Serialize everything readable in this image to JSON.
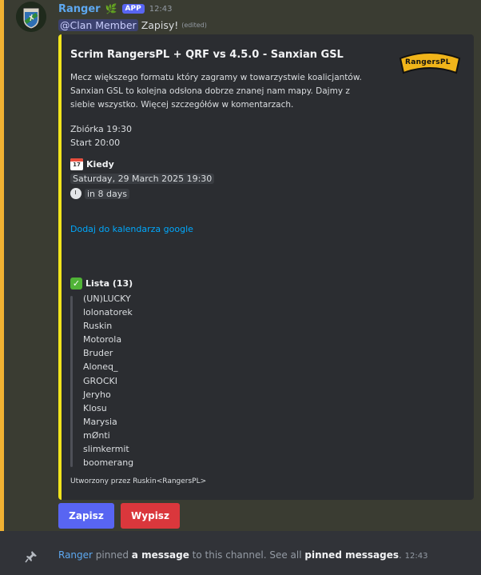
{
  "message": {
    "username": "Ranger",
    "badge": "APP",
    "time": "12:43",
    "mention": "@Clan Member",
    "text": "Zapisy!",
    "edited": "(edited)"
  },
  "embed": {
    "title": "Scrim RangersPL + QRF vs 4.5.0 - Sanxian GSL",
    "description_lines": [
      "Mecz większego formatu który zagramy w towarzystwie koalicjantów.",
      "Sanxian GSL to kolejna odsłona dobrze znanej nam mapy. Dajmy z",
      "siebie wszystko. Więcej szczegółów w komentarzach."
    ],
    "gather": "Zbiórka 19:30",
    "start": "Start 20:00",
    "thumbnail_text": "RangersPL",
    "calendar_day": "17",
    "when_label": "Kiedy",
    "when_date": "Saturday, 29 March 2025 19:30",
    "relative": "in 8 days",
    "calendar_link": "Dodaj do kalendarza google",
    "list_title": "Lista (13)",
    "list": [
      "(UN)LUCKY",
      "lolonatorek",
      "Ruskin",
      "Motorola",
      "Bruder",
      "Aloneq_",
      "GROCKI",
      "Jeryho",
      "Klosu",
      "Marysia",
      "mØnti",
      "slimkermit",
      "boomerang"
    ],
    "footer": "Utworzony przez Ruskin<RangersPL>"
  },
  "buttons": {
    "signup": "Zapisz",
    "signout": "Wypisz"
  },
  "pin": {
    "user": "Ranger",
    "text1": "pinned",
    "strong1": "a message",
    "text2": "to this channel. See all",
    "strong2": "pinned messages",
    "text3": ".",
    "time": "12:43"
  }
}
